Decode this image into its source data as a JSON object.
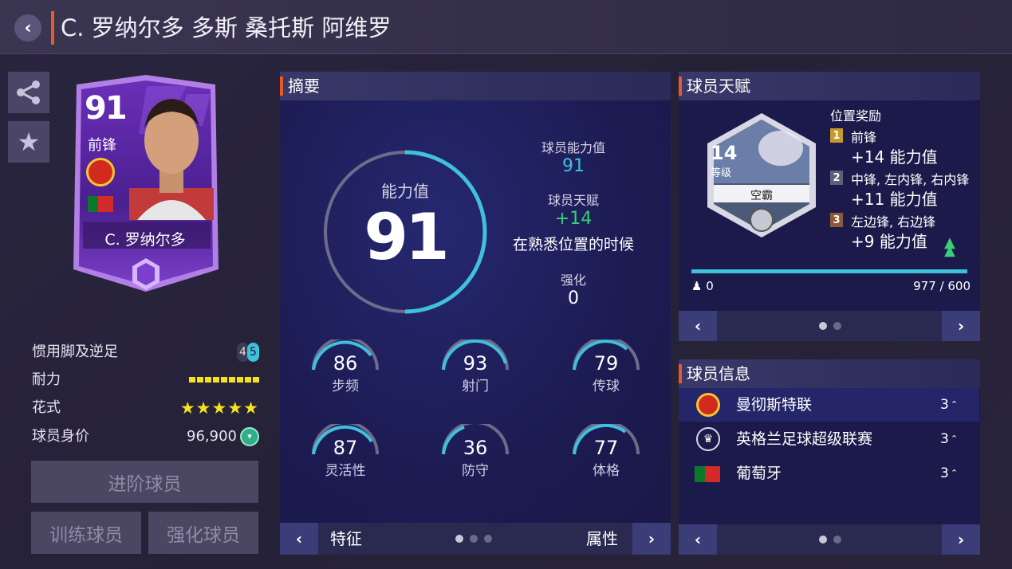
{
  "header": {
    "title": "C. 罗纳尔多 多斯 桑托斯 阿维罗",
    "back_icon": "‹"
  },
  "card": {
    "rating": "91",
    "position": "前锋",
    "name": "C. 罗纳尔多"
  },
  "left_stats": {
    "foot_label": "惯用脚及逆足",
    "foot_a": "4",
    "foot_b": "5",
    "stamina_label": "耐力",
    "skill_label": "花式",
    "skill_stars": "★★★★★",
    "value_label": "球员身价",
    "value": "96,900"
  },
  "buttons": {
    "advance": "进阶球员",
    "train": "训练球员",
    "enhance": "强化球员"
  },
  "summary": {
    "title": "摘要",
    "ability_label": "能力值",
    "ability_value": "91",
    "ovr_label": "球员能力值",
    "ovr_value": "91",
    "talent_label": "球员天赋",
    "talent_value": "+14",
    "talent_note": "在熟悉位置的时候",
    "enhance_label": "强化",
    "enhance_value": "0",
    "attrs": [
      {
        "value": "86",
        "label": "步频"
      },
      {
        "value": "93",
        "label": "射门"
      },
      {
        "value": "79",
        "label": "传球"
      },
      {
        "value": "87",
        "label": "灵活性"
      },
      {
        "value": "36",
        "label": "防守"
      },
      {
        "value": "77",
        "label": "体格"
      }
    ],
    "footer_left": "特征",
    "footer_right": "属性",
    "prev": "‹",
    "next": "›"
  },
  "talent": {
    "title": "球员天赋",
    "level": "14",
    "level_label": "等级",
    "name": "空霸",
    "bonus_title": "位置奖励",
    "bonuses": [
      {
        "rank": "1",
        "positions": "前锋",
        "value": "+14 能力值",
        "color": "#c99a2a"
      },
      {
        "rank": "2",
        "positions": "中锋, 左内锋, 右内锋",
        "value": "+11 能力值",
        "color": "#5b6277"
      },
      {
        "rank": "3",
        "positions": "左边锋, 右边锋",
        "value": "+9 能力值",
        "color": "#8a5a3a"
      }
    ],
    "progress": 1.0,
    "count": "0",
    "xp": "977 / 600",
    "prev": "‹",
    "next": "›"
  },
  "info": {
    "title": "球员信息",
    "rows": [
      {
        "name": "曼彻斯特联",
        "count": "3",
        "icon": "club-badge-icon"
      },
      {
        "name": "英格兰足球超级联赛",
        "count": "3",
        "icon": "league-icon"
      },
      {
        "name": "葡萄牙",
        "count": "3",
        "icon": "portugal-flag-icon"
      }
    ],
    "prev": "‹",
    "next": "›"
  },
  "colors": {
    "accent": "#e75a2e",
    "cyan": "#3fc0dc",
    "green": "#35d07a",
    "yellow": "#f2e31c"
  }
}
